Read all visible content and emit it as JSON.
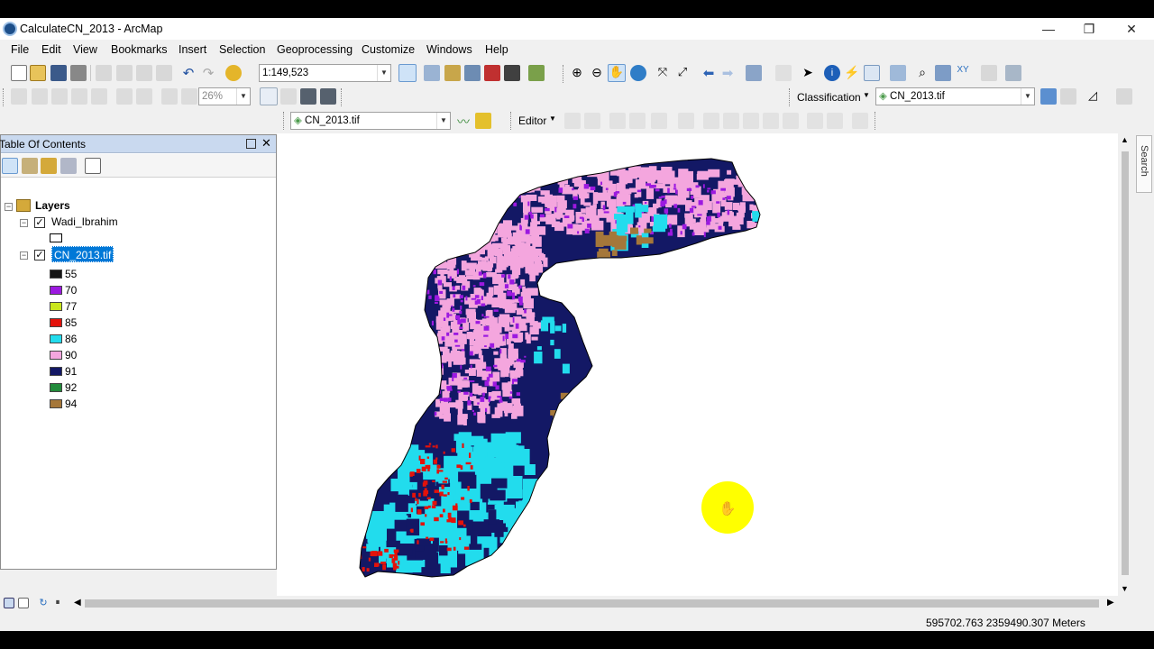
{
  "window": {
    "title": "CalculateCN_2013 - ArcMap",
    "minimize": "—",
    "restore": "❐",
    "close": "✕"
  },
  "menu": [
    "File",
    "Edit",
    "View",
    "Bookmarks",
    "Insert",
    "Selection",
    "Geoprocessing",
    "Customize",
    "Windows",
    "Help"
  ],
  "toolbar": {
    "scale": "1:149,523",
    "zoom_percent": "26%",
    "classification_label": "Classification",
    "classification_layer": "CN_2013.tif",
    "spatial_analyst_layer": "CN_2013.tif",
    "editor_label": "Editor"
  },
  "toc": {
    "title": "Table Of Contents",
    "root": "Layers",
    "layers": [
      {
        "name": "Wadi_Ibrahim",
        "checked": true
      },
      {
        "name": "CN_2013.tif",
        "checked": true,
        "selected": true
      }
    ],
    "legend": [
      {
        "label": "55",
        "color": "#151515"
      },
      {
        "label": "70",
        "color": "#9c19e0"
      },
      {
        "label": "77",
        "color": "#c9e61d"
      },
      {
        "label": "85",
        "color": "#e3120b"
      },
      {
        "label": "86",
        "color": "#22dced"
      },
      {
        "label": "90",
        "color": "#f4a6de"
      },
      {
        "label": "91",
        "color": "#131865"
      },
      {
        "label": "92",
        "color": "#228b3b"
      },
      {
        "label": "94",
        "color": "#a5773a"
      }
    ]
  },
  "search_tab": "Search",
  "status": {
    "coordinates": "595702.763  2359490.307 Meters"
  }
}
